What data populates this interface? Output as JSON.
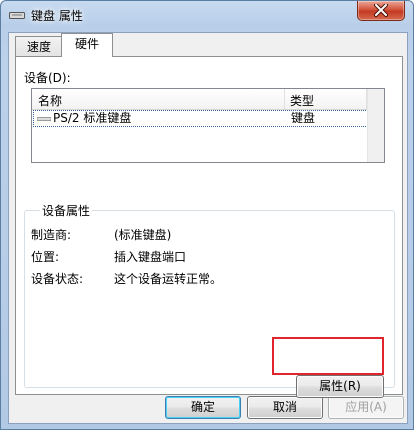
{
  "window": {
    "title": "键盘 属性"
  },
  "tabs": [
    {
      "label": "速度"
    },
    {
      "label": "硬件"
    }
  ],
  "devices": {
    "label": "设备(D):",
    "columns": [
      "名称",
      "类型"
    ],
    "rows": [
      {
        "name": "PS/2 标准键盘",
        "type": "键盘"
      }
    ]
  },
  "properties": {
    "title": "设备属性",
    "items": [
      {
        "label": "制造商:",
        "value": "(标准键盘)"
      },
      {
        "label": "位置:",
        "value": "插入键盘端口"
      },
      {
        "label": "设备状态:",
        "value": "这个设备运转正常。"
      }
    ],
    "button": "属性(R)"
  },
  "buttons": {
    "ok": "确定",
    "cancel": "取消",
    "apply": "应用(A)"
  },
  "colors": {
    "highlight": "#e0262b",
    "title_gradient": "#c7daf0"
  }
}
